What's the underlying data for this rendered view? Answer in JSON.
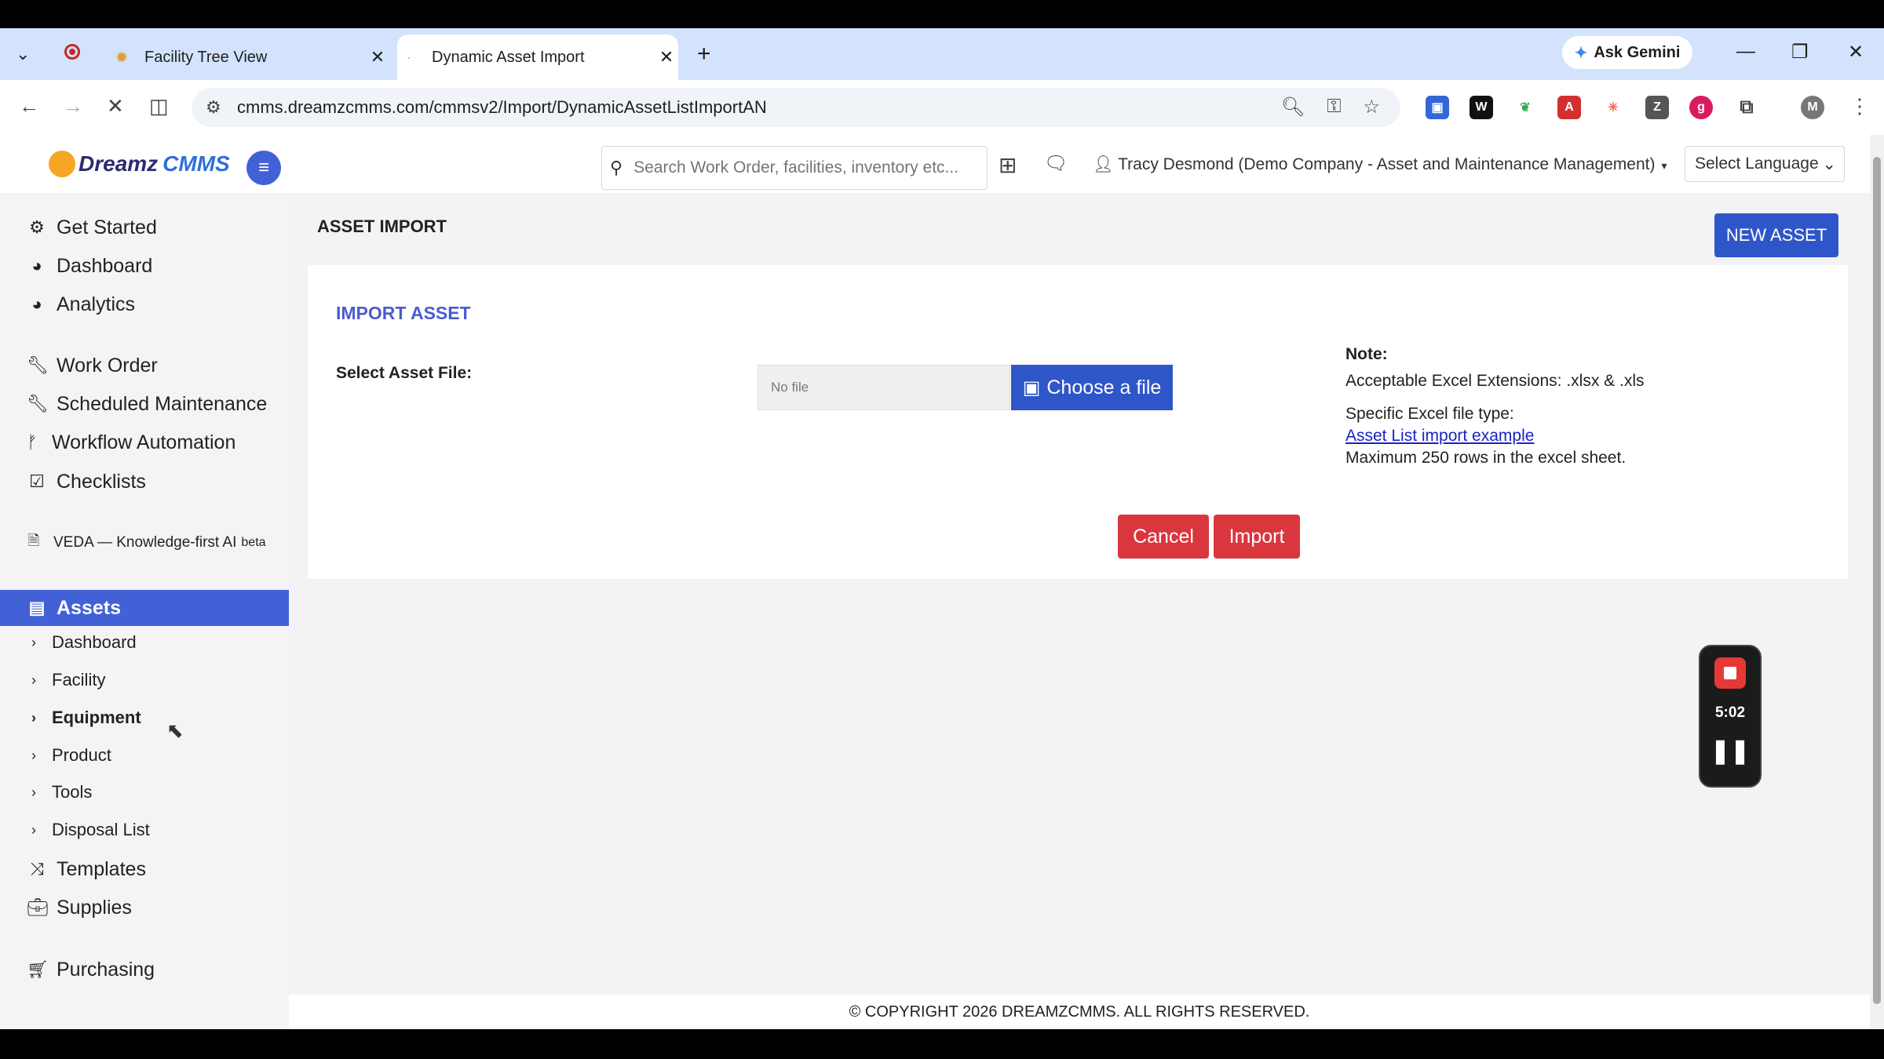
{
  "browser": {
    "tabs": [
      {
        "title": "Facility Tree View"
      },
      {
        "title": "Dynamic Asset Import"
      }
    ],
    "ask_gemini": "Ask Gemini",
    "url": "cmms.dreamzcmms.com/cmmsv2/Import/DynamicAssetListImportAN",
    "profile_initial": "M"
  },
  "header": {
    "logo_part1": "Dreamz",
    "logo_part2": "CMMS",
    "search_placeholder": "Search Work Order, facilities, inventory etc...",
    "user": "Tracy Desmond (Demo Company - Asset and Maintenance Management)",
    "language": "Select Language"
  },
  "sidebar": {
    "items": [
      {
        "label": "Get Started",
        "icon": "gears-icon"
      },
      {
        "label": "Dashboard",
        "icon": "dashboard-icon"
      },
      {
        "label": "Analytics",
        "icon": "analytics-icon"
      },
      {
        "label": "Work Order",
        "icon": "wrench-icon"
      },
      {
        "label": "Scheduled Maintenance",
        "icon": "wrench-icon"
      },
      {
        "label": "Workflow Automation",
        "icon": "workflow-icon"
      },
      {
        "label": "Checklists",
        "icon": "checkbox-icon"
      },
      {
        "label": "VEDA — Knowledge-first AI",
        "badge": "beta",
        "icon": "document-icon"
      },
      {
        "label": "Assets",
        "icon": "assets-icon"
      },
      {
        "label": "Templates",
        "icon": "shuffle-icon"
      },
      {
        "label": "Supplies",
        "icon": "briefcase-icon"
      },
      {
        "label": "Purchasing",
        "icon": "cart-icon"
      }
    ],
    "asset_subitems": [
      "Dashboard",
      "Facility",
      "Equipment",
      "Product",
      "Tools",
      "Disposal List"
    ]
  },
  "main": {
    "page_title": "ASSET IMPORT",
    "new_asset_button": "NEW ASSET",
    "card_title": "IMPORT ASSET",
    "field_label": "Select Asset File:",
    "file_placeholder": "No file",
    "choose_file_button": "Choose a file",
    "note": {
      "heading": "Note:",
      "line1": "Acceptable Excel Extensions: .xlsx & .xls",
      "line2": "Specific Excel file type:",
      "link": "Asset List import example",
      "line3": "Maximum 250 rows in the excel sheet."
    },
    "cancel_button": "Cancel",
    "import_button": "Import",
    "footer": "© COPYRIGHT 2026 DREAMZCMMS. ALL RIGHTS RESERVED."
  },
  "recorder": {
    "time": "5:02"
  },
  "colors": {
    "accent": "#2f56c9",
    "sidebar_active": "#4361d6",
    "danger": "#d9363e",
    "link": "#1a22c8"
  }
}
